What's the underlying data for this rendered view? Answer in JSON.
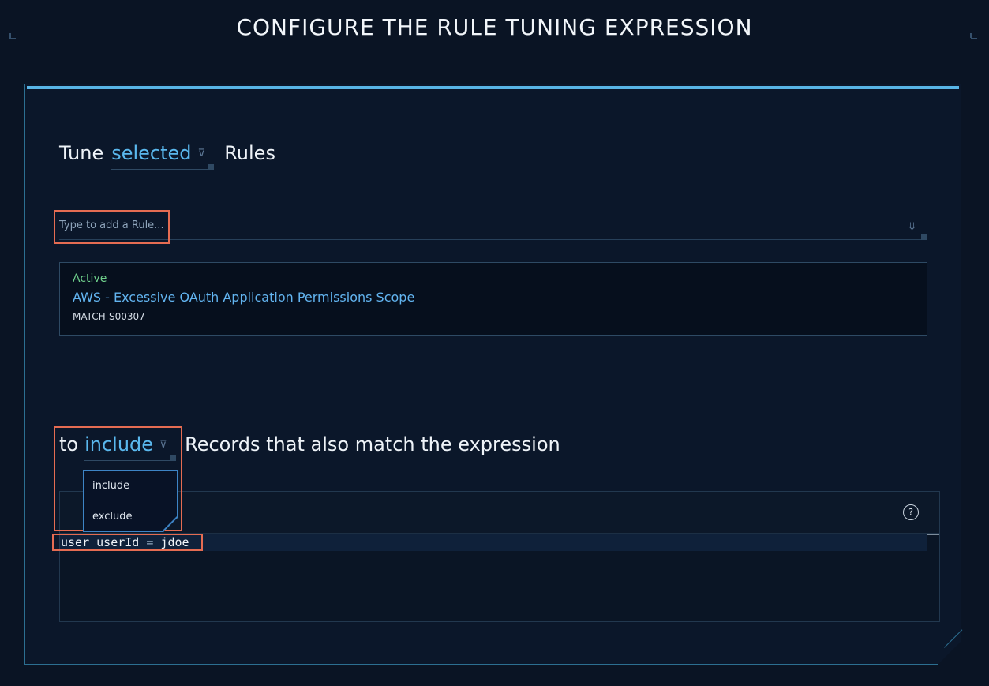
{
  "page": {
    "title": "CONFIGURE THE RULE TUNING EXPRESSION"
  },
  "tune_sentence": {
    "prefix": "Tune",
    "selector_value": "selected",
    "suffix": "Rules"
  },
  "rule_search": {
    "placeholder": "Type to add a Rule..."
  },
  "rule_card": {
    "status": "Active",
    "name": "AWS - Excessive OAuth Application Permissions Scope",
    "id": "MATCH-S00307"
  },
  "match_sentence": {
    "prefix": "to",
    "selector_value": "include",
    "suffix": "Records that also match the expression"
  },
  "match_dropdown": {
    "options": [
      "include",
      "exclude"
    ]
  },
  "editor": {
    "help_label": "?",
    "code": {
      "left": "user_userId",
      "operator": "=",
      "right": "jdoe"
    }
  },
  "colors": {
    "accent": "#5ab8ee",
    "status_active": "#6fd08c",
    "highlight": "#e56c52",
    "panel_border": "#2c6f91"
  },
  "icons": {
    "caret": "chevron-down-icon",
    "double_caret": "double-chevron-down-icon",
    "help": "help-icon"
  }
}
